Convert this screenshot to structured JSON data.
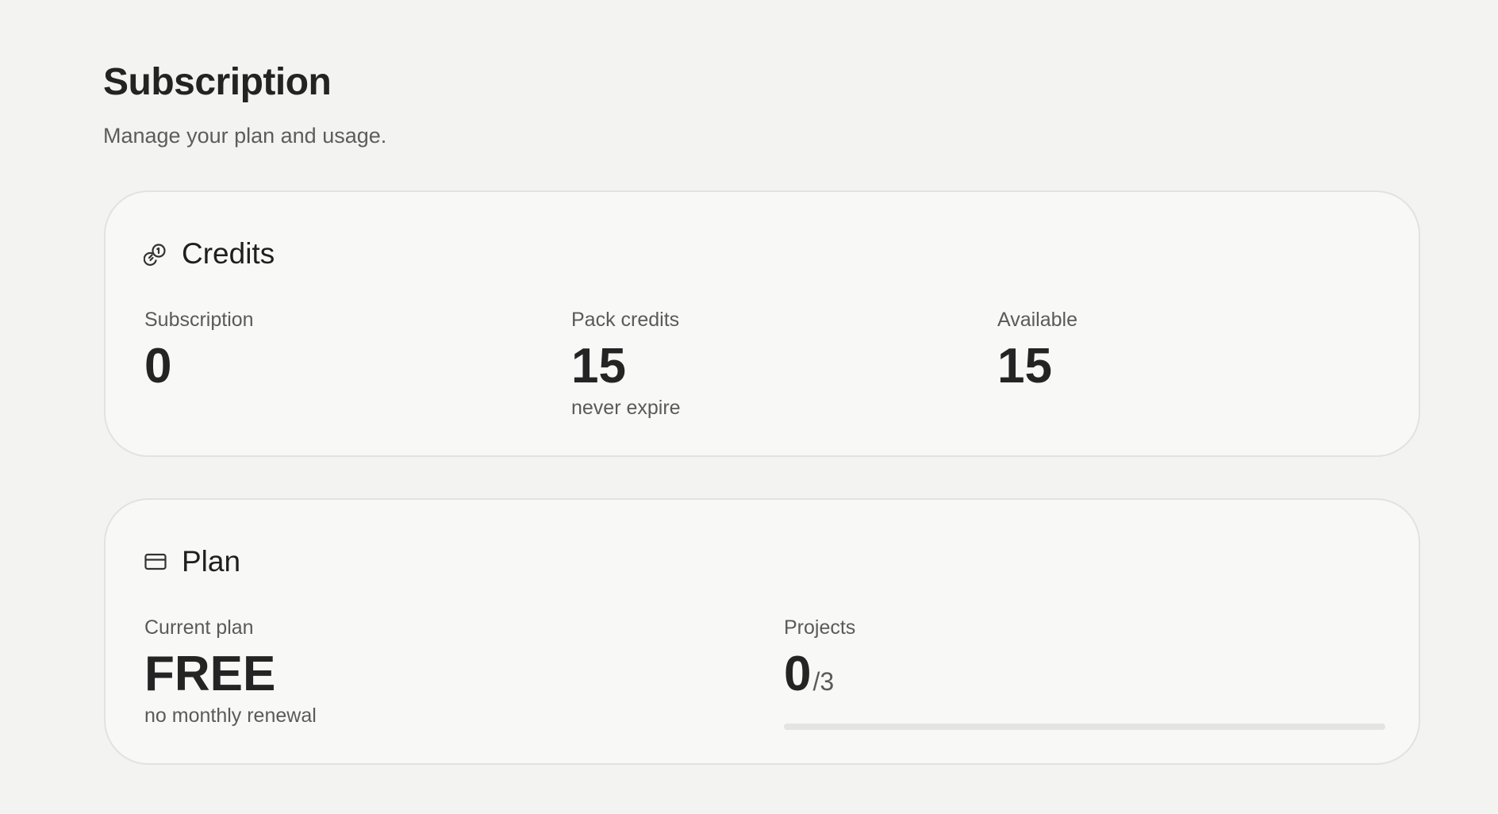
{
  "page": {
    "title": "Subscription",
    "subtitle": "Manage your plan and usage."
  },
  "credits": {
    "title": "Credits",
    "icon": "coins-icon",
    "stats": [
      {
        "label": "Subscription",
        "value": "0",
        "note": ""
      },
      {
        "label": "Pack credits",
        "value": "15",
        "note": "never expire"
      },
      {
        "label": "Available",
        "value": "15",
        "note": ""
      }
    ]
  },
  "plan": {
    "title": "Plan",
    "icon": "credit-card-icon",
    "current_plan": {
      "label": "Current plan",
      "value": "FREE",
      "note": "no monthly renewal"
    },
    "projects": {
      "label": "Projects",
      "used": "0",
      "limit_text": "/3",
      "progress_fraction": 0
    }
  },
  "colors": {
    "background": "#f3f3f2",
    "card_background": "#f8f8f7",
    "card_border": "#e2e2e0",
    "progress_track": "#e4e4e2",
    "text_primary": "#242424",
    "text_secondary": "#5a5a5a"
  }
}
